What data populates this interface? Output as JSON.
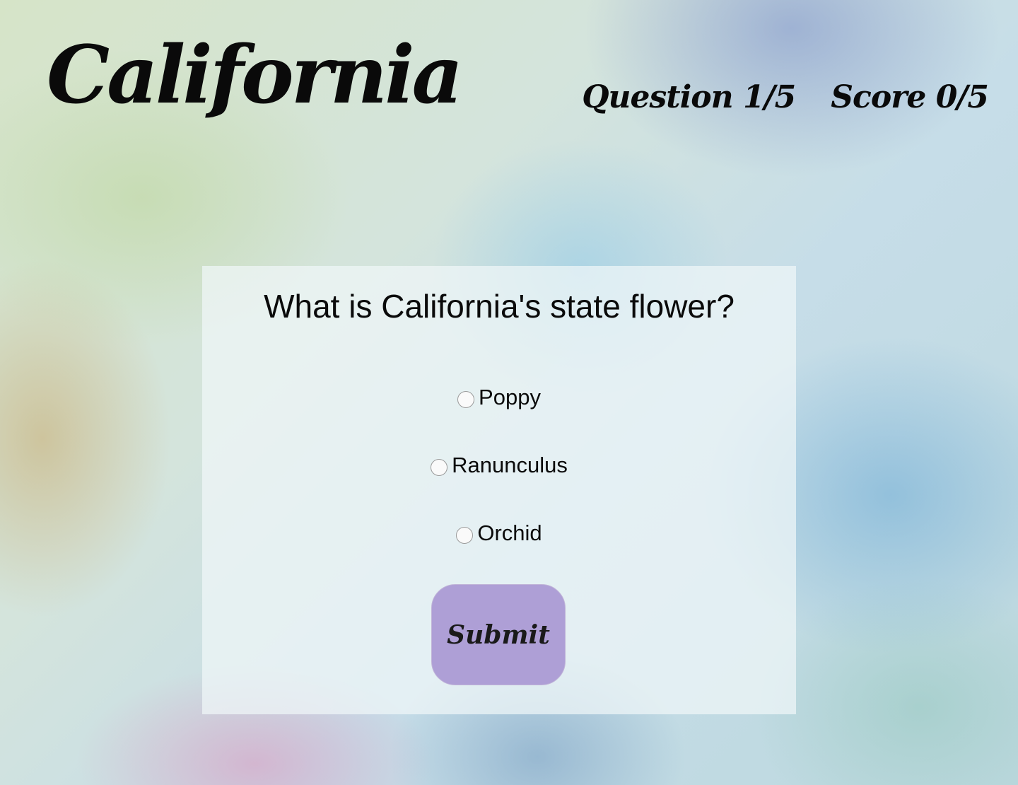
{
  "header": {
    "title": "California",
    "question_progress": "Question 1/5",
    "score": "Score 0/5"
  },
  "quiz": {
    "question": "What is California's state flower?",
    "options": [
      "Poppy",
      "Ranunculus",
      "Orchid"
    ],
    "selected": null,
    "submit_label": "Submit"
  },
  "colors": {
    "submit_bg": "#ae9fd6",
    "text": "#0a0a0a",
    "card_bg": "#f0f6f8"
  }
}
